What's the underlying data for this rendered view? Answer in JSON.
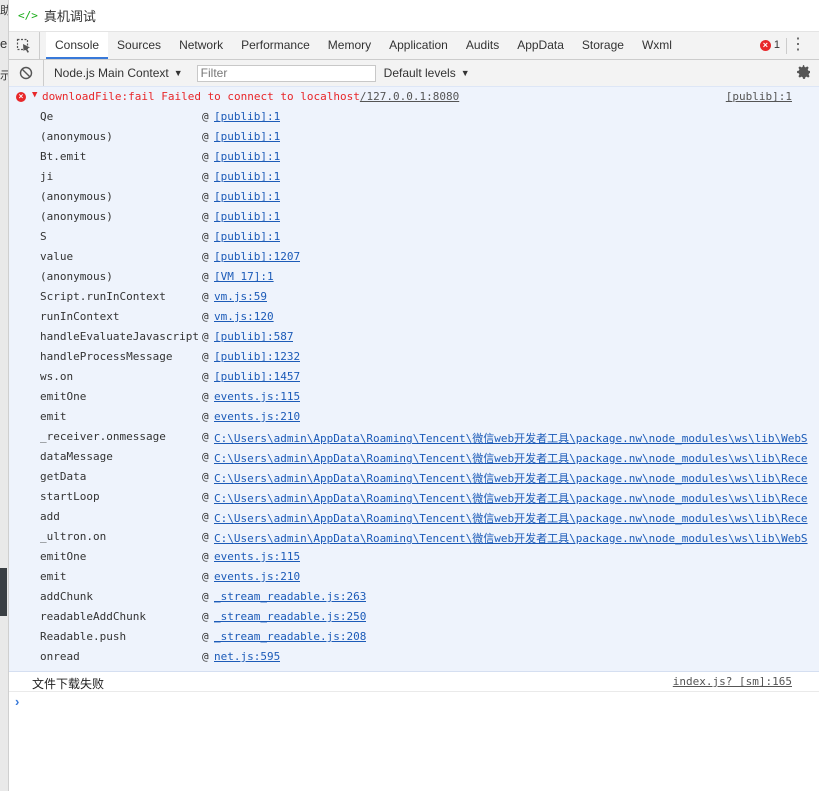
{
  "window": {
    "title": "真机调试",
    "title_icon": "</>"
  },
  "background": {
    "edge_fragments": [
      "助",
      "e",
      "示"
    ]
  },
  "tabs": [
    {
      "label": "Console",
      "active": true
    },
    {
      "label": "Sources"
    },
    {
      "label": "Network"
    },
    {
      "label": "Performance"
    },
    {
      "label": "Memory"
    },
    {
      "label": "Application"
    },
    {
      "label": "Audits"
    },
    {
      "label": "AppData"
    },
    {
      "label": "Storage"
    },
    {
      "label": "Wxml"
    }
  ],
  "error_count": "1",
  "toolbar": {
    "context": "Node.js Main Context",
    "filter_placeholder": "Filter",
    "levels": "Default levels"
  },
  "error": {
    "message": "downloadFile:fail Failed to connect to localhost",
    "message_link": "/127.0.0.1:8080",
    "source": "[publib]:1",
    "frames": [
      {
        "fn": "Qe",
        "loc": "[publib]:1"
      },
      {
        "fn": "(anonymous)",
        "loc": "[publib]:1"
      },
      {
        "fn": "Bt.emit",
        "loc": "[publib]:1"
      },
      {
        "fn": "ji",
        "loc": "[publib]:1"
      },
      {
        "fn": "(anonymous)",
        "loc": "[publib]:1"
      },
      {
        "fn": "(anonymous)",
        "loc": "[publib]:1"
      },
      {
        "fn": "S",
        "loc": "[publib]:1"
      },
      {
        "fn": "value",
        "loc": "[publib]:1207"
      },
      {
        "fn": "(anonymous)",
        "loc": "[VM 17]:1"
      },
      {
        "fn": "Script.runInContext",
        "loc": "vm.js:59"
      },
      {
        "fn": "runInContext",
        "loc": "vm.js:120"
      },
      {
        "fn": "handleEvaluateJavascript",
        "loc": "[publib]:587"
      },
      {
        "fn": "handleProcessMessage",
        "loc": "[publib]:1232"
      },
      {
        "fn": "ws.on",
        "loc": "[publib]:1457"
      },
      {
        "fn": "emitOne",
        "loc": "events.js:115"
      },
      {
        "fn": "emit",
        "loc": "events.js:210"
      },
      {
        "fn": "_receiver.onmessage",
        "loc": "C:\\Users\\admin\\AppData\\Roaming\\Tencent\\微信web开发者工具\\package.nw\\node_modules\\ws\\lib\\WebS"
      },
      {
        "fn": "dataMessage",
        "loc": "C:\\Users\\admin\\AppData\\Roaming\\Tencent\\微信web开发者工具\\package.nw\\node_modules\\ws\\lib\\Rece"
      },
      {
        "fn": "getData",
        "loc": "C:\\Users\\admin\\AppData\\Roaming\\Tencent\\微信web开发者工具\\package.nw\\node_modules\\ws\\lib\\Rece"
      },
      {
        "fn": "startLoop",
        "loc": "C:\\Users\\admin\\AppData\\Roaming\\Tencent\\微信web开发者工具\\package.nw\\node_modules\\ws\\lib\\Rece"
      },
      {
        "fn": "add",
        "loc": "C:\\Users\\admin\\AppData\\Roaming\\Tencent\\微信web开发者工具\\package.nw\\node_modules\\ws\\lib\\Rece"
      },
      {
        "fn": "_ultron.on",
        "loc": "C:\\Users\\admin\\AppData\\Roaming\\Tencent\\微信web开发者工具\\package.nw\\node_modules\\ws\\lib\\WebS"
      },
      {
        "fn": "emitOne",
        "loc": "events.js:115"
      },
      {
        "fn": "emit",
        "loc": "events.js:210"
      },
      {
        "fn": "addChunk",
        "loc": "_stream_readable.js:263"
      },
      {
        "fn": "readableAddChunk",
        "loc": "_stream_readable.js:250"
      },
      {
        "fn": "Readable.push",
        "loc": "_stream_readable.js:208"
      },
      {
        "fn": "onread",
        "loc": "net.js:595"
      }
    ]
  },
  "log": {
    "text": "文件下载失败",
    "source": "index.js? [sm]:165"
  },
  "prompt": {
    "symbol": "›"
  },
  "colors": {
    "error": "#e8272a",
    "accent": "#3879d9",
    "link": "#1c5bb8",
    "error_bg": "#eef3fc"
  }
}
